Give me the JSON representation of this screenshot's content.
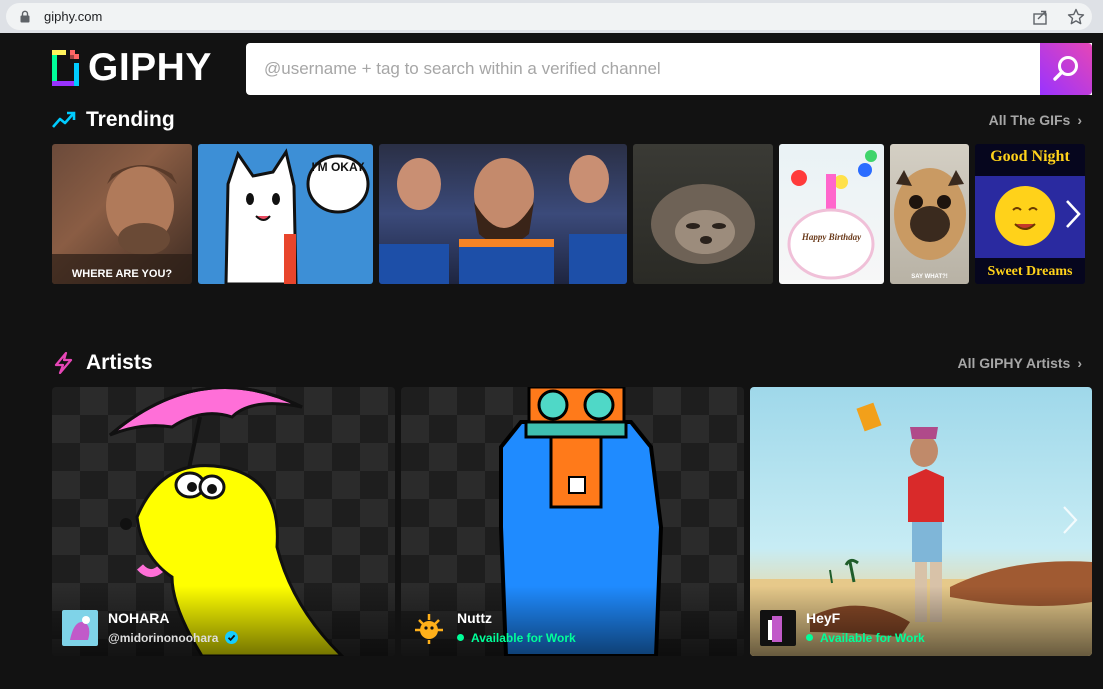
{
  "browser": {
    "url": "giphy.com"
  },
  "header": {
    "logo_text": "GIPHY",
    "search_placeholder": "@username + tag to search within a verified channel"
  },
  "trending": {
    "title": "Trending",
    "link_label": "All The GIFs",
    "gifs": [
      {
        "caption": "WHERE ARE YOU?"
      },
      {
        "caption": "I'M OKAY"
      },
      {
        "caption": ""
      },
      {
        "caption": ""
      },
      {
        "caption": "Happy Birthday"
      },
      {
        "caption": "SAY WHAT?!"
      },
      {
        "caption_top": "Good Night",
        "caption_bottom": "Sweet Dreams"
      }
    ]
  },
  "artists": {
    "title": "Artists",
    "link_label": "All GIPHY Artists",
    "items": [
      {
        "name": "NOHARA",
        "handle": "@midorinonoohara",
        "verified": true
      },
      {
        "name": "Nuttz",
        "status": "Available for Work"
      },
      {
        "name": "HeyF",
        "status": "Available for Work"
      }
    ]
  },
  "colors": {
    "background": "#121212",
    "search_gradient_start": "#9933ff",
    "search_gradient_end": "#e646b6",
    "available": "#00ff99",
    "trending_icon": "#00ccff",
    "artists_icon": "#e646b6"
  }
}
